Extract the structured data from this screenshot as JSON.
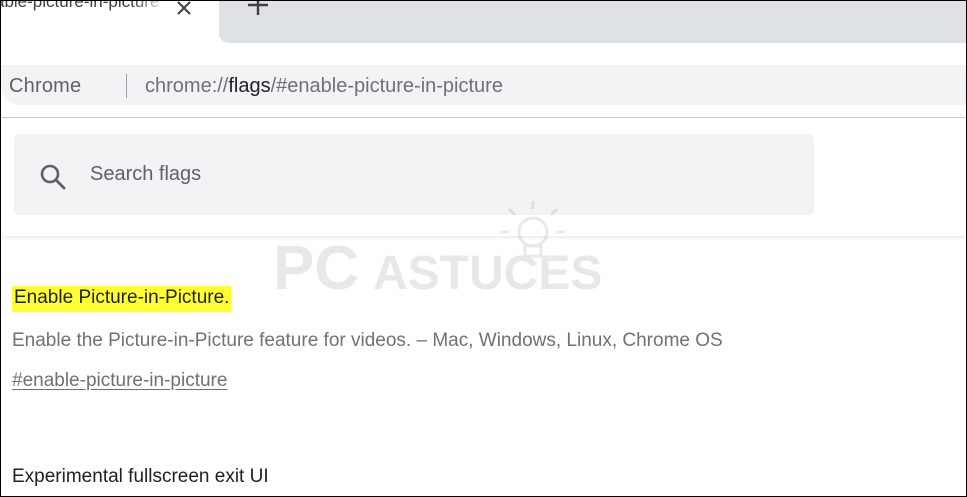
{
  "tab": {
    "title": "able-picture-in-picture",
    "close_icon": "close-icon",
    "new_tab_icon": "plus-icon"
  },
  "omnibox": {
    "site_label": "Chrome",
    "url_prefix": "chrome://",
    "url_host": "flags",
    "url_suffix": "/#enable-picture-in-picture"
  },
  "search": {
    "icon": "search-icon",
    "placeholder": "Search flags"
  },
  "watermark": {
    "text_left": "PC",
    "text_right": "ASTUCES"
  },
  "flags": [
    {
      "title": "Enable Picture-in-Picture.",
      "description": "Enable the Picture-in-Picture feature for videos. – Mac, Windows, Linux, Chrome OS",
      "anchor": "#enable-picture-in-picture"
    },
    {
      "title": "Experimental fullscreen exit UI"
    }
  ],
  "colors": {
    "highlight": "#ffff33",
    "tab_strip_inactive": "#dee1e6",
    "omnibox_bg": "#f1f3f4",
    "text_secondary": "#6e7276"
  }
}
